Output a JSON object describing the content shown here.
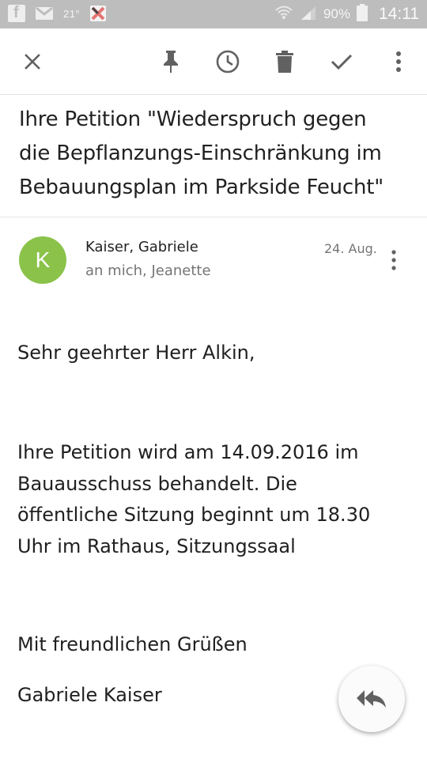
{
  "status_bar": {
    "temperature": "21°",
    "battery_percent": "90%",
    "time": "14:11",
    "icons": [
      "facebook-icon",
      "gmail-icon",
      "calendar-icon",
      "wifi-icon",
      "signal-icon",
      "battery-icon"
    ]
  },
  "toolbar": {
    "icons": [
      "close-icon",
      "pin-icon",
      "snooze-clock-icon",
      "trash-icon",
      "check-icon",
      "more-vert-icon"
    ]
  },
  "email": {
    "subject_lines": [
      "Ihre Petition \"Wiederspruch gegen",
      "die Bepflanzungs-Einschränkung im",
      "Bebauungsplan im Parkside Feucht\""
    ],
    "sender": {
      "avatar_letter": "K",
      "avatar_color": "#8bc34a",
      "name": "Kaiser, Gabriele",
      "recipients": "an mich, Jeanette",
      "date": "24. Aug."
    },
    "body": {
      "greeting": "Sehr geehrter Herr Alkin,",
      "main_lines": [
        "Ihre Petition wird am 14.09.2016 im",
        "Bauausschuss behandelt. Die",
        "öffentliche Sitzung beginnt um 18.30",
        "Uhr im Rathaus, Sitzungssaal"
      ],
      "closing": "Mit freundlichen Grüßen",
      "signature": "Gabriele Kaiser"
    }
  },
  "fab": {
    "icon": "reply-all-icon"
  }
}
